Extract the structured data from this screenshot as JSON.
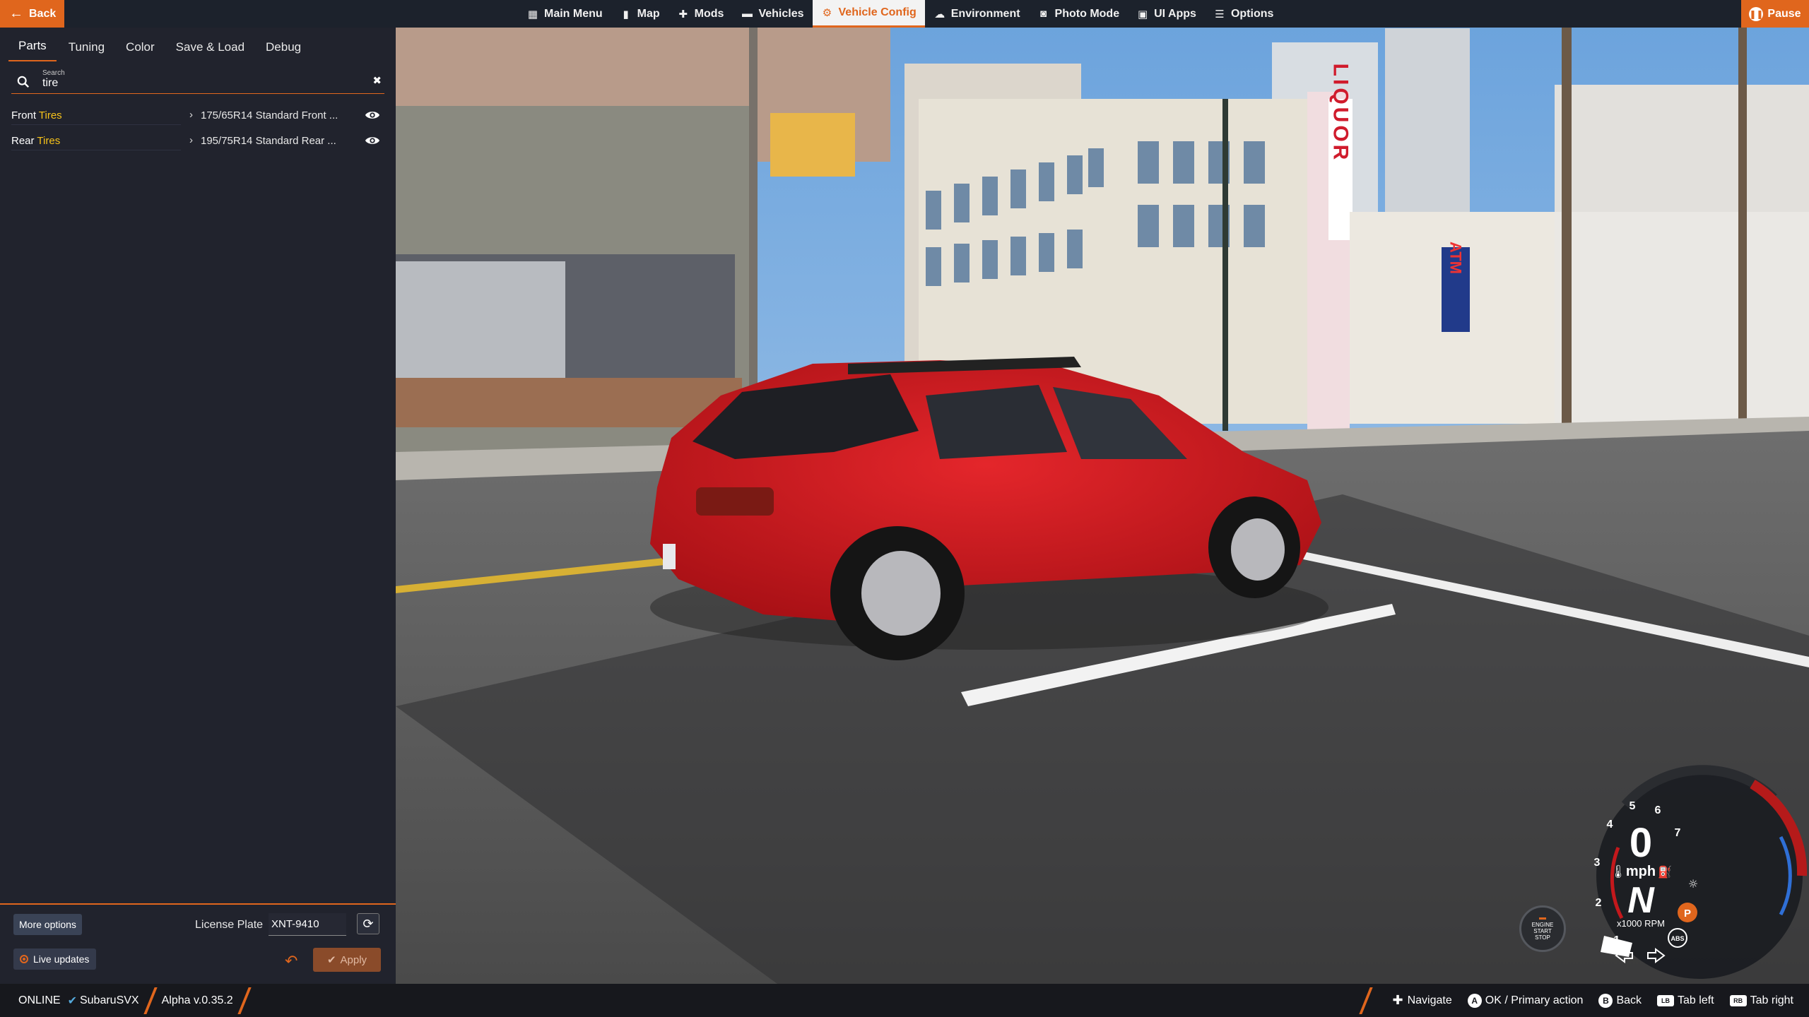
{
  "topbar": {
    "back_label": "Back",
    "nav": [
      {
        "label": "Main Menu",
        "icon": "main-menu-icon",
        "active": false
      },
      {
        "label": "Map",
        "icon": "map-icon",
        "active": false
      },
      {
        "label": "Mods",
        "icon": "puzzle-icon",
        "active": false
      },
      {
        "label": "Vehicles",
        "icon": "car-icon",
        "active": false
      },
      {
        "label": "Vehicle Config",
        "icon": "car-config-icon",
        "active": true
      },
      {
        "label": "Environment",
        "icon": "weather-icon",
        "active": false
      },
      {
        "label": "Photo Mode",
        "icon": "camera-icon",
        "active": false
      },
      {
        "label": "UI Apps",
        "icon": "ui-apps-icon",
        "active": false
      },
      {
        "label": "Options",
        "icon": "sliders-icon",
        "active": false
      }
    ],
    "pause_label": "Pause"
  },
  "panel": {
    "tabs": [
      "Parts",
      "Tuning",
      "Color",
      "Save & Load",
      "Debug"
    ],
    "active_tab": "Parts",
    "search": {
      "label": "Search",
      "value": "tire"
    },
    "parts": [
      {
        "name_prefix": "Front ",
        "name_highlight": "Tires",
        "value": "175/65R14 Standard Front ..."
      },
      {
        "name_prefix": "Rear ",
        "name_highlight": "Tires",
        "value": "195/75R14 Standard Rear ..."
      }
    ],
    "footer": {
      "more_options": "More options",
      "plate_label": "License Plate",
      "plate_value": "XNT-9410",
      "live_updates": "Live updates",
      "apply": "Apply"
    }
  },
  "status": {
    "online": "ONLINE",
    "user": "SubaruSVX",
    "version": "Alpha v.0.35.2",
    "hints": [
      {
        "key": "",
        "label": "Navigate",
        "icon": "dpad-icon"
      },
      {
        "key": "A",
        "label": "OK / Primary action",
        "icon": "a-button-icon"
      },
      {
        "key": "B",
        "label": "Back",
        "icon": "b-button-icon"
      },
      {
        "key": "LB",
        "label": "Tab left",
        "icon": "lb-button-icon"
      },
      {
        "key": "RB",
        "label": "Tab right",
        "icon": "rb-button-icon"
      }
    ]
  },
  "hud": {
    "speed": "0",
    "unit": "mph",
    "gear": "N",
    "rpm_label": "x1000 RPM",
    "ticks": [
      "1",
      "2",
      "3",
      "4",
      "5",
      "6",
      "7"
    ],
    "engine_btn": [
      "ENGINE",
      "START",
      "STOP"
    ],
    "park_label": "P",
    "abs_label": "ABS"
  },
  "scene": {
    "signs": [
      "LIQUOR",
      "ATM"
    ]
  },
  "colors": {
    "accent": "#e0661d",
    "highlight": "#f6c21a",
    "panel": "#21232d",
    "car": "#c8141a"
  }
}
